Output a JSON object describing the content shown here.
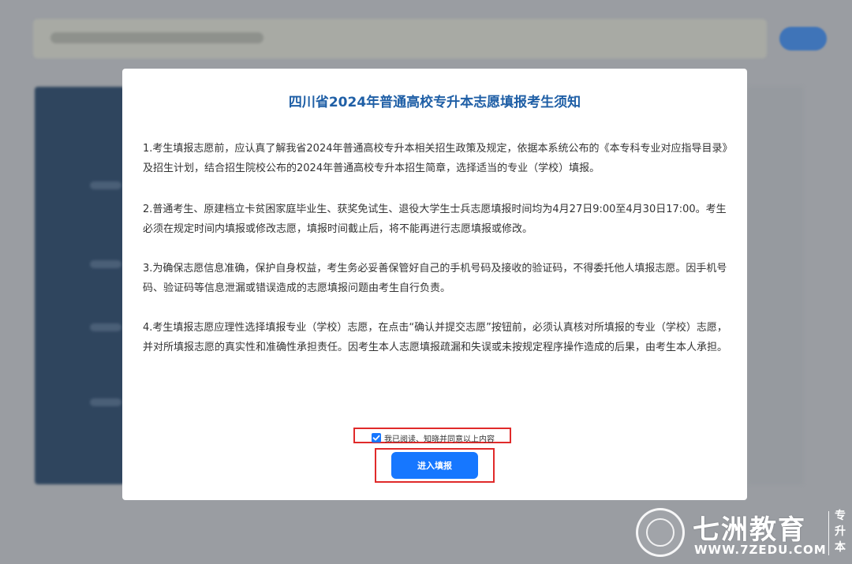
{
  "modal": {
    "title": "四川省2024年普通高校专升本志愿填报考生须知",
    "notices": [
      "1.考生填报志愿前，应认真了解我省2024年普通高校专升本相关招生政策及规定，依据本系统公布的《本专科专业对应指导目录》及招生计划，结合招生院校公布的2024年普通高校专升本招生简章，选择适当的专业（学校）填报。",
      "2.普通考生、原建档立卡贫困家庭毕业生、获奖免试生、退役大学生士兵志愿填报时间均为4月27日9:00至4月30日17:00。考生必须在规定时间内填报或修改志愿，填报时间截止后，将不能再进行志愿填报或修改。",
      "3.为确保志愿信息准确，保护自身权益，考生务必妥善保管好自己的手机号码及接收的验证码，不得委托他人填报志愿。因手机号码、验证码等信息泄漏或错误造成的志愿填报问题由考生自行负责。",
      "4.考生填报志愿应理性选择填报专业（学校）志愿，在点击“确认并提交志愿”按钮前，必须认真核对所填报的专业（学校）志愿，并对所填报志愿的真实性和准确性承担责任。因考生本人志愿填报疏漏和失误或未按规定程序操作造成的后果，由考生本人承担。"
    ],
    "agree_label": "我已阅读、知晓并同意以上内容",
    "agree_checked": true,
    "enter_button": "进入填报"
  },
  "watermark": {
    "brand": "七洲教育",
    "url": "WWW.7ZEDU.COM",
    "side_text": [
      "专",
      "升",
      "本"
    ]
  },
  "colors": {
    "title": "#1f5fa6",
    "button": "#1677ff",
    "highlight_border": "#e02a2a"
  }
}
